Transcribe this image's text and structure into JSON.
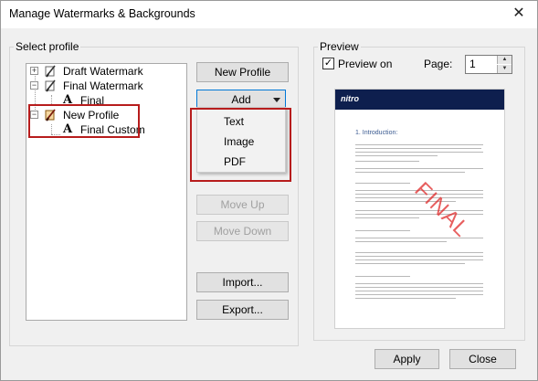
{
  "window": {
    "title": "Manage Watermarks & Backgrounds",
    "close_glyph": "✕"
  },
  "select_profile": {
    "legend": "Select profile",
    "tree": [
      {
        "label": "Draft Watermark",
        "expander": "+"
      },
      {
        "label": "Final Watermark",
        "expander": "−"
      },
      {
        "label": "Final",
        "icon": "A"
      },
      {
        "label": "New Profile",
        "expander": "−"
      },
      {
        "label": "Final Custom",
        "icon": "A"
      }
    ]
  },
  "buttons": {
    "new_profile": "New Profile",
    "add": "Add",
    "move_up": "Move Up",
    "move_down": "Move Down",
    "import": "Import...",
    "export": "Export...",
    "apply": "Apply",
    "close": "Close"
  },
  "add_menu": {
    "items": [
      "Text",
      "Image",
      "PDF"
    ]
  },
  "preview": {
    "legend": "Preview",
    "preview_on_label": "Preview on",
    "preview_on_checked": true,
    "checkmark": "✓",
    "page_label": "Page:",
    "page_value": "1",
    "spin_up": "▲",
    "spin_down": "▼",
    "doc_logo": "nitro",
    "doc_heading": "1. Introduction:",
    "watermark_text": "FINAL"
  },
  "colors": {
    "highlight": "#b71c1c",
    "watermark": "#e02a2a",
    "doc_header": "#0e1f4e"
  }
}
